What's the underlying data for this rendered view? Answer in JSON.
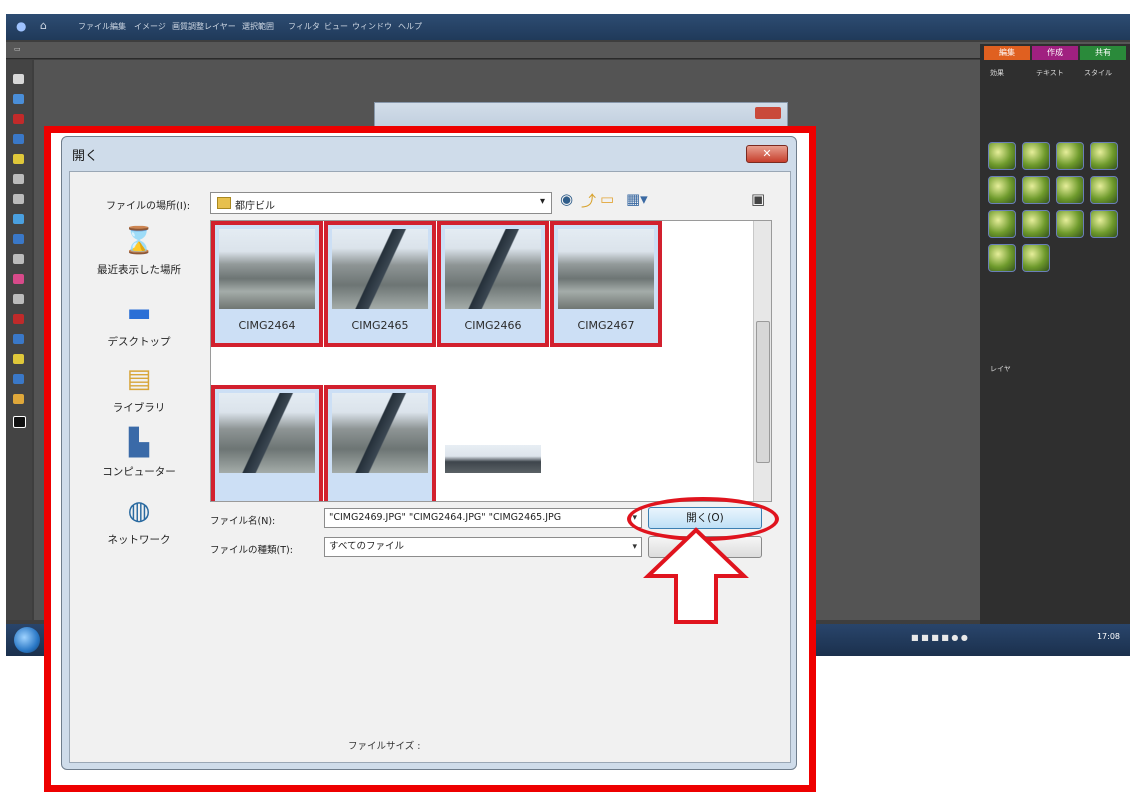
{
  "app": {
    "menu": [
      "ファイル",
      "編集",
      "イメージ",
      "画質調整",
      "レイヤー",
      "選択範囲",
      "フィルタ",
      "ビュー",
      "ウィンドウ",
      "ヘルプ"
    ],
    "panel_tabs": [
      "編集",
      "作成",
      "共有"
    ],
    "panel_sub": [
      "効果",
      "テキスト",
      "スタイル"
    ],
    "panel_layers": "レイヤ",
    "taskbar_clock": "17:08"
  },
  "dialog": {
    "title": "開く",
    "close_label": "✕",
    "look_in_label": "ファイルの場所(I):",
    "look_in_value": "都庁ビル",
    "places": [
      {
        "label": "最近表示した場所",
        "icon": "recent-places-icon"
      },
      {
        "label": "デスクトップ",
        "icon": "desktop-icon"
      },
      {
        "label": "ライブラリ",
        "icon": "libraries-icon"
      },
      {
        "label": "コンピューター",
        "icon": "computer-icon"
      },
      {
        "label": "ネットワーク",
        "icon": "network-icon"
      }
    ],
    "files": [
      {
        "name": "CIMG2464",
        "selected": true
      },
      {
        "name": "CIMG2465",
        "selected": true
      },
      {
        "name": "CIMG2466",
        "selected": true
      },
      {
        "name": "CIMG2467",
        "selected": true
      },
      {
        "name": "",
        "selected": true
      },
      {
        "name": "",
        "selected": true
      },
      {
        "name": "",
        "selected": false
      }
    ],
    "filename_label": "ファイル名(N):",
    "filename_value": "\"CIMG2469.JPG\" \"CIMG2464.JPG\" \"CIMG2465.JPG",
    "filetype_label": "ファイルの種類(T):",
    "filetype_value": "すべてのファイル",
    "open_button": "開く(O)",
    "cancel_button": "",
    "file_size_label": "ファイルサイズ :"
  },
  "colors": {
    "annotation_red": "#e0141e",
    "frame_red": "#ee0000",
    "selection_blue": "#ccdff5"
  }
}
